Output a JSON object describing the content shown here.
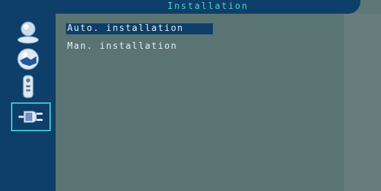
{
  "header": {
    "title": "Installation"
  },
  "menu": {
    "items": [
      {
        "label": "Auto. installation",
        "selected": true
      },
      {
        "label": "Man. installation",
        "selected": false
      }
    ]
  },
  "sidebar": {
    "icons": [
      {
        "name": "user-icon"
      },
      {
        "name": "globe-icon"
      },
      {
        "name": "remote-control-icon"
      },
      {
        "name": "plug-icon",
        "active": true
      }
    ]
  },
  "colors": {
    "panel": "#0e3e6a",
    "title_text": "#4fd2c6",
    "menu_text": "#e9f0f0",
    "background": "#5a7373",
    "active_border": "#3fc6cf"
  }
}
